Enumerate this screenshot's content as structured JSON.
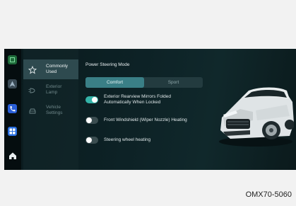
{
  "rail": {
    "icons": [
      "app-square-icon",
      "navigation-icon",
      "phone-icon",
      "apps-grid-icon",
      "home-icon"
    ]
  },
  "menu": {
    "items": [
      {
        "label_line1": "Commonly",
        "label_line2": "Used",
        "icon": "star-icon",
        "active": true
      },
      {
        "label_line1": "Exterior",
        "label_line2": "Lamp",
        "icon": "lamp-icon",
        "active": false
      },
      {
        "label_line1": "Vehicle",
        "label_line2": "Settings",
        "icon": "car-settings-icon",
        "active": false
      }
    ]
  },
  "power_steering": {
    "heading": "Power Steering Mode",
    "options": [
      "Comfort",
      "Sport"
    ],
    "selected": "Comfort"
  },
  "settings": [
    {
      "label_line1": "Exterior Rearview Mirrors Folded",
      "label_line2": "Automatically When Locked",
      "on": true
    },
    {
      "label_line1": "Front Windshield (Wiper Nozzle) Heating",
      "label_line2": "",
      "on": false
    },
    {
      "label_line1": "Steering wheel heating",
      "label_line2": "",
      "on": false
    }
  ],
  "caption": "OMX70-5060",
  "colors": {
    "accent": "#34b3a8",
    "segment_selected": "#3a7f86",
    "screen_bg": "#0d2226",
    "rail_bg": "#050d0f"
  }
}
